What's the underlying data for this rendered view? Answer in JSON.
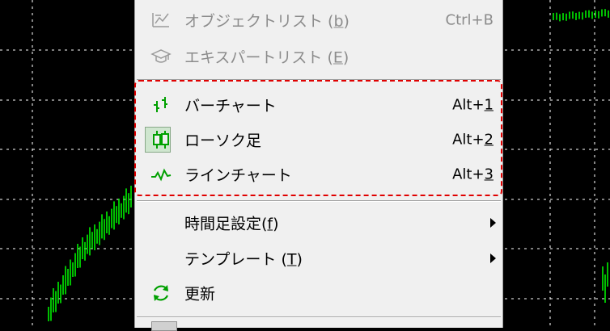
{
  "menu": {
    "items": [
      {
        "label": "オブジェクトリスト (",
        "ul": "b",
        "tail": ")",
        "shortcut": "Ctrl+B",
        "disabled": true,
        "icon": "object-list-icon"
      },
      {
        "label": "エキスパートリスト (",
        "ul": "E",
        "tail": ")",
        "shortcut": "",
        "disabled": true,
        "icon": "expert-hat-icon"
      },
      {
        "label": "バーチャート",
        "shortcut_pre": "Alt+",
        "shortcut_ul": "1",
        "icon": "bar-chart-icon"
      },
      {
        "label": "ローソク足",
        "shortcut_pre": "Alt+",
        "shortcut_ul": "2",
        "icon": "candlestick-icon",
        "checked": true
      },
      {
        "label": "ラインチャート",
        "shortcut_pre": "Alt+",
        "shortcut_ul": "3",
        "icon": "line-chart-icon"
      },
      {
        "label": "時間足設定(",
        "ul": "f",
        "tail": ")",
        "submenu": true
      },
      {
        "label": "テンプレート (",
        "ul": "T",
        "tail": ")",
        "submenu": true
      },
      {
        "label": "更新",
        "icon": "refresh-icon"
      }
    ]
  },
  "colors": {
    "chart_green": "#00ff00",
    "grid": "#ffffff",
    "highlight": "#e00000"
  }
}
